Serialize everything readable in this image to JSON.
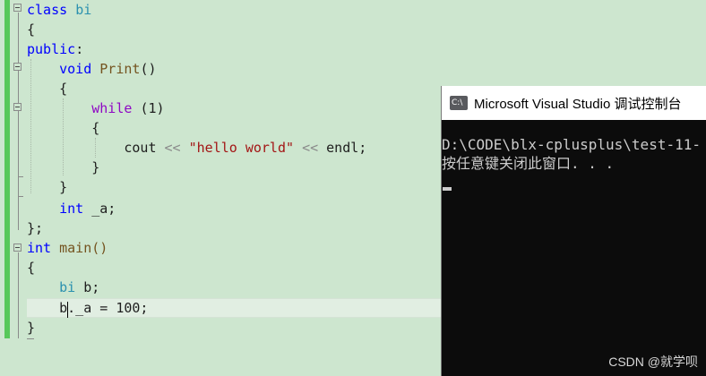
{
  "editor": {
    "lines": {
      "l1": {
        "kw": "class",
        "name": "bi"
      },
      "l2": "{",
      "l3": {
        "kw": "public",
        "colon": ":"
      },
      "l4": {
        "ret": "void",
        "fn": "Print",
        "paren": "()"
      },
      "l5": "{",
      "l6": {
        "kw": "while",
        "cond": "(1)"
      },
      "l7": "{",
      "l8": {
        "ident": "cout",
        "op1": "<<",
        "str": "\"hello world\"",
        "op2": "<<",
        "endl": "endl;"
      },
      "l9": "}",
      "l10": "}",
      "l11": {
        "type": "int",
        "name": "_a;"
      },
      "l12": "};",
      "l13": {
        "type": "int",
        "fn": "main()"
      },
      "l14": "{",
      "l15": {
        "type": "bi",
        "var": "b;"
      },
      "l16": {
        "text": "b._a = 100;"
      },
      "l17": "}"
    }
  },
  "console": {
    "title": "Microsoft Visual Studio 调试控制台",
    "icon_label": "C:\\",
    "line1": "D:\\CODE\\blx-cplusplus\\test-11-",
    "line2": "按任意键关闭此窗口. . ."
  },
  "watermark": "CSDN @就学呗",
  "colors": {
    "keyword": "#0000ff",
    "flow": "#8f08c4",
    "type": "#2b91af",
    "string": "#a31515",
    "background": "#cde6cf"
  }
}
